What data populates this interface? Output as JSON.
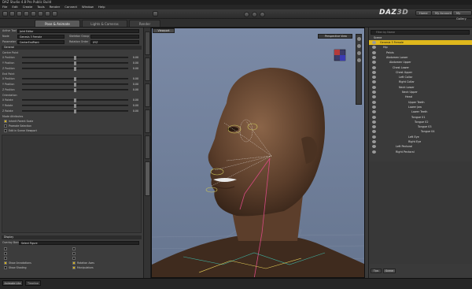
{
  "app": {
    "title": "DAZ Studio 4.8 Pro Public Build"
  },
  "menu": [
    "File",
    "Edit",
    "Create",
    "Tools",
    "Render",
    "Connect",
    "Window",
    "Help"
  ],
  "tabs": [
    {
      "label": "Pose & Animate",
      "active": true
    },
    {
      "label": "Lights & Cameras",
      "active": false
    },
    {
      "label": "Render",
      "active": false
    }
  ],
  "top_right": {
    "logo_text": "DAZ",
    "logo_num": "3D",
    "buttons": [
      "Home",
      "My Account",
      "My Gallery"
    ]
  },
  "left": {
    "active_tool_label": "Active Tool",
    "active_tool_value": "Joint Editor",
    "node_label": "Node",
    "node_value": "Genesis 3 Female",
    "skeleton_label": "Skeleton Group",
    "parameter_label": "Parameter",
    "parameter_value": "CenterEndPoint",
    "rotation_label": "Rotation Order",
    "rotation_value": "XYZ",
    "section_general": "General",
    "center_point": "Center Point",
    "end_point": "End Point",
    "orientation": "Orientation",
    "sliders": [
      {
        "label": "X Position",
        "value": "0.00"
      },
      {
        "label": "Y Position",
        "value": "0.00"
      },
      {
        "label": "Z Position",
        "value": "0.00"
      },
      {
        "label": "X Position",
        "value": "0.00"
      },
      {
        "label": "Y Position",
        "value": "0.00"
      },
      {
        "label": "Z Position",
        "value": "0.00"
      },
      {
        "label": "X Rotate",
        "value": "0.00"
      },
      {
        "label": "Y Rotate",
        "value": "0.00"
      },
      {
        "label": "Z Rotate",
        "value": "0.00"
      }
    ],
    "mode_attributes": "Mode Attributes",
    "checks": [
      {
        "label": "Inherit Parent Scale",
        "on": true
      },
      {
        "label": "Promote Selection",
        "on": false
      },
      {
        "label": "Edit in Scene Viewport",
        "on": false
      }
    ],
    "display_label": "Display",
    "overlay_label": "Overlay Bones",
    "overlay_value": "Select Figure",
    "bottom_checks": [
      {
        "label": "",
        "on": false
      },
      {
        "label": "",
        "on": false
      },
      {
        "label": "",
        "on": false
      },
      {
        "label": "Show Annotations",
        "on": true
      },
      {
        "label": "Show Shading",
        "on": false
      }
    ],
    "bottom_checks_right": [
      {
        "label": "",
        "on": false
      },
      {
        "label": "",
        "on": false
      },
      {
        "label": "",
        "on": false
      },
      {
        "label": "Rotation Axes",
        "on": true
      },
      {
        "label": "Manipulators",
        "on": true
      }
    ]
  },
  "viewport": {
    "tab": "Viewport",
    "camera": "Perspective View"
  },
  "scene": {
    "search_placeholder": "Filter by Name",
    "root": "Scene",
    "items": [
      {
        "label": "Genesis 3 Female",
        "depth": 0,
        "selected": true
      },
      {
        "label": "Hip",
        "depth": 1
      },
      {
        "label": "Pelvis",
        "depth": 2
      },
      {
        "label": "Abdomen Lower",
        "depth": 2
      },
      {
        "label": "Abdomen Upper",
        "depth": 3
      },
      {
        "label": "Chest Lower",
        "depth": 4
      },
      {
        "label": "Chest Upper",
        "depth": 5
      },
      {
        "label": "Left Collar",
        "depth": 6
      },
      {
        "label": "Right Collar",
        "depth": 6
      },
      {
        "label": "Neck Lower",
        "depth": 6
      },
      {
        "label": "Neck Upper",
        "depth": 7
      },
      {
        "label": "Head",
        "depth": 8
      },
      {
        "label": "Upper Teeth",
        "depth": 9
      },
      {
        "label": "Lower Jaw",
        "depth": 9
      },
      {
        "label": "Lower Teeth",
        "depth": 10
      },
      {
        "label": "Tongue 01",
        "depth": 10
      },
      {
        "label": "Tongue 02",
        "depth": 11
      },
      {
        "label": "Tongue 03",
        "depth": 12
      },
      {
        "label": "Tongue 04",
        "depth": 13
      },
      {
        "label": "Left Eye",
        "depth": 9
      },
      {
        "label": "Right Eye",
        "depth": 9
      },
      {
        "label": "Left Pectoral",
        "depth": 5
      },
      {
        "label": "Right Pectoral",
        "depth": 5
      }
    ],
    "bottom_tabs": [
      "Tips",
      "Scene"
    ]
  },
  "bottom": {
    "tabs": [
      "Animate Lite",
      "Timeline"
    ]
  },
  "colors": {
    "accent": "#e0b81c",
    "selected_row": "#e0b81c"
  }
}
